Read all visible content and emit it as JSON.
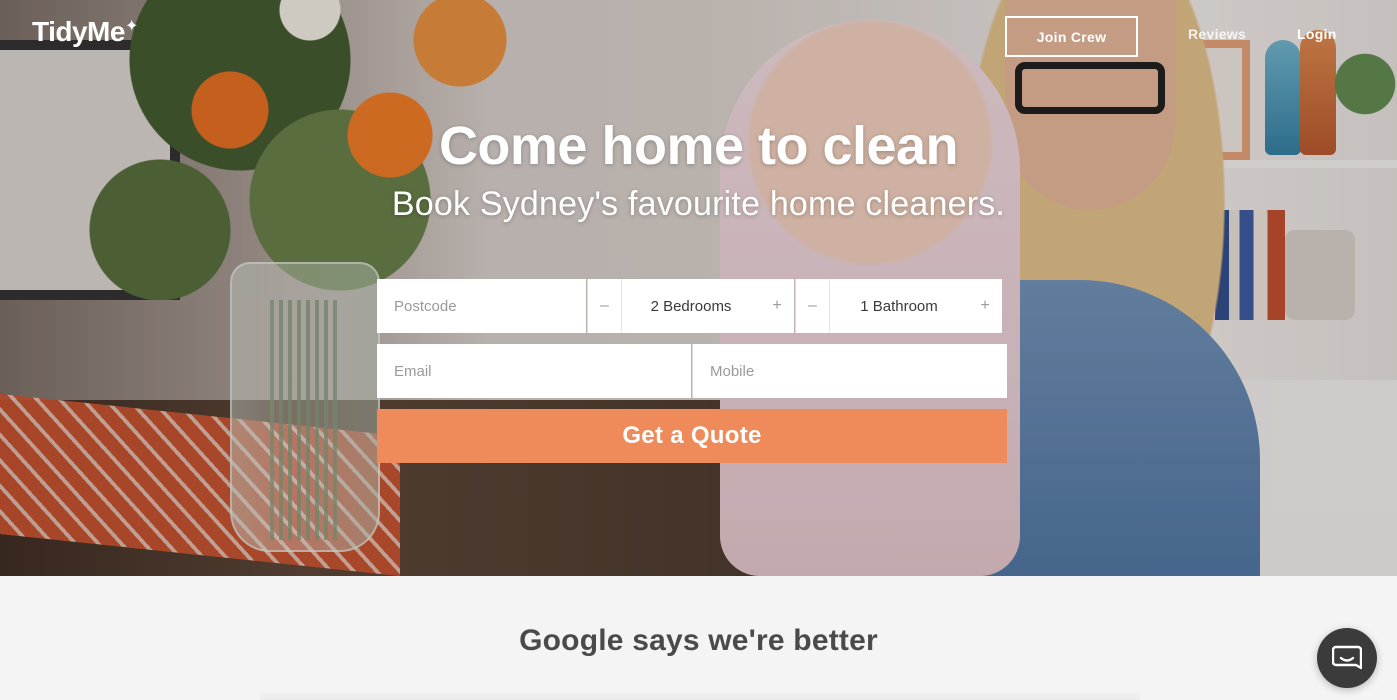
{
  "brand": {
    "logo_text": "TidyMe",
    "logo_spark": "✦"
  },
  "nav": {
    "join_crew": "Join Crew",
    "reviews": "Reviews",
    "login": "Login"
  },
  "hero": {
    "headline": "Come home to clean",
    "subheadline": "Book Sydney's favourite home cleaners."
  },
  "form": {
    "postcode_placeholder": "Postcode",
    "bedrooms_value": "2 Bedrooms",
    "bathrooms_value": "1 Bathroom",
    "minus_symbol": "–",
    "plus_symbol": "+",
    "email_placeholder": "Email",
    "mobile_placeholder": "Mobile",
    "submit_label": "Get a Quote"
  },
  "section": {
    "title": "Google says we're better"
  },
  "colors": {
    "accent": "#ef8a5a",
    "chat_button": "#3b3b3b",
    "page_background": "#f4f4f4"
  },
  "icons": {
    "chat": "chat-bubble-icon"
  }
}
